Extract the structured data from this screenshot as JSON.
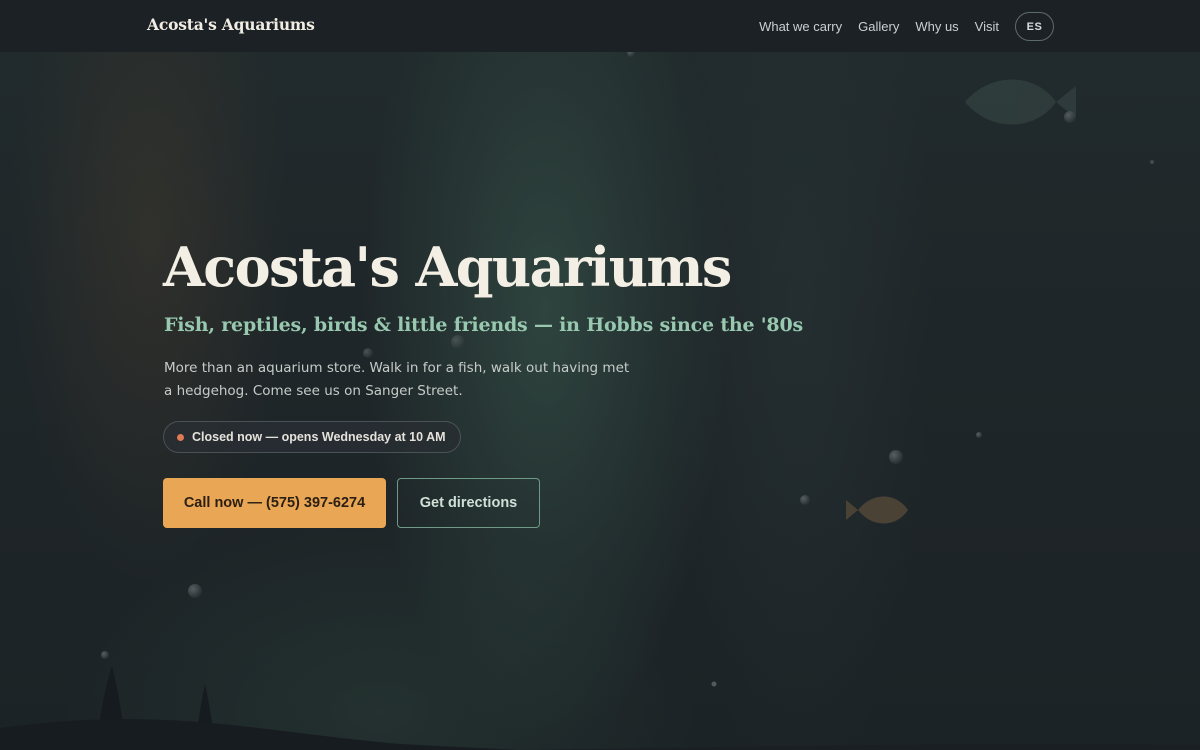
{
  "header": {
    "brand": "Acosta's Aquariums",
    "nav": [
      "What we carry",
      "Gallery",
      "Why us",
      "Visit"
    ],
    "lang_toggle": "ES"
  },
  "hero": {
    "title": "Acosta's Aquariums",
    "subtitle": "Fish, reptiles, birds & little friends — in Hobbs since the '80s",
    "description": "More than an aquarium store. Walk in for a fish, walk out having met a hedgehog. Come see us on Sanger Street.",
    "status": "Closed now — opens Wednesday at 10 AM",
    "cta_call": "Call now — (575) 397-6274",
    "cta_directions": "Get directions"
  },
  "colors": {
    "background": "#1b2025",
    "accent": "#e9a654",
    "subtitle": "#98c9b0",
    "status_dot": "#e07a55",
    "outline_button": "#6f9a88"
  },
  "icons": [
    "status-dot-icon",
    "fish-silhouette",
    "seaweed",
    "bubbles"
  ]
}
